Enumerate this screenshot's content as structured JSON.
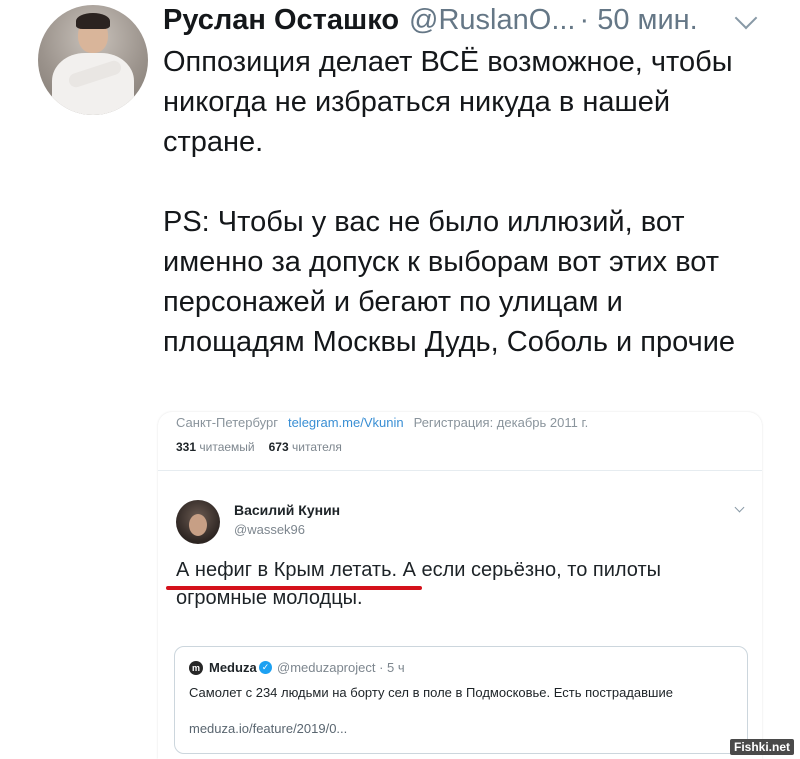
{
  "tweet": {
    "author_name": "Руслан Осташко",
    "author_handle": "@RuslanO...",
    "time": "· 50 мин.",
    "paragraph_1": "Оппозиция делает ВСЁ возможное, чтобы никогда не избраться никуда в нашей стране.",
    "paragraph_2": "PS: Чтобы у вас не было иллюзий, вот именно за допуск к выборам вот этих вот персонажей и бегают по улицам и площадям Москвы Дудь, Соболь и прочие"
  },
  "screenshot": {
    "location": "Санкт-Петербург",
    "link": "telegram.me/Vkunin",
    "registration": "Регистрация: декабрь 2011 г.",
    "following_count": "331",
    "following_label": "читаемый",
    "followers_count": "673",
    "followers_label": "читателя",
    "quoted_author": "Василий Кунин",
    "quoted_handle": "@wassek96",
    "quoted_text": "А нефиг в Крым летать. А если серьёзно, то пилоты огромные молодцы.",
    "card": {
      "logo_letter": "m",
      "name": "Meduza",
      "verified_glyph": "✓",
      "handle_time": "@meduzaproject · 5 ч",
      "text": "Самолет с 234 людьми на борту сел в поле в Подмосковье. Есть пострадавшие",
      "link": "meduza.io/feature/2019/0..."
    }
  },
  "watermark": "Fishki.net",
  "colors": {
    "text": "#14171a",
    "secondary": "#657786",
    "link": "#3a8fd4",
    "underline": "#d4111b",
    "verified": "#1da1f2"
  }
}
